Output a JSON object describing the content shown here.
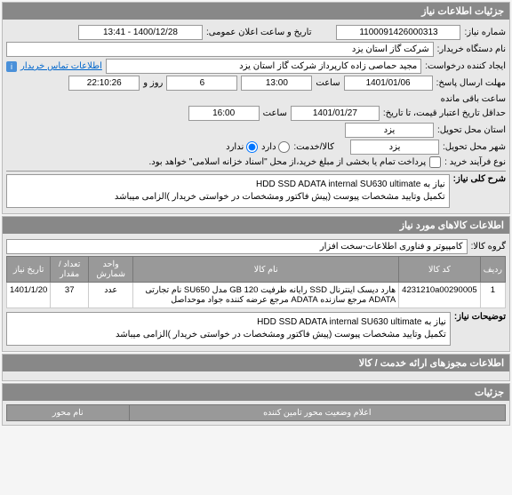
{
  "headers": {
    "main": "جزئیات اطلاعات نیاز",
    "items": "اطلاعات کالاهای مورد نیاز",
    "permits": "اطلاعات مجوزهای ارائه خدمت / کالا",
    "details": "جزئیات"
  },
  "labels": {
    "need_no": "شماره نیاز:",
    "pub_datetime": "تاریخ و ساعت اعلان عمومی:",
    "buyer_org": "نام دستگاه خریدار:",
    "creator": "ایجاد کننده درخواست:",
    "contact_link": "اطلاعات تماس خریدار",
    "deadline_resp": "مهلت ارسال پاسخ:",
    "credit_from": "حداقل تاریخ اعتبار قیمت، تا تاریخ:",
    "time_label": "ساعت",
    "day_and": "روز و",
    "remaining": "ساعت باقی مانده",
    "delivery_prov": "استان محل تحویل:",
    "delivery_city": "شهر محل تحویل:",
    "related_sep": "کالا/خدمت:",
    "related_yes": "دارد",
    "related_no": "ندارد",
    "purchase_type": "نوع فرآیند خرید :",
    "purchase_note": "پرداخت تمام یا بخشی از مبلغ خرید،از محل \"اسناد خزانه اسلامی\" خواهد بود.",
    "need_desc": "شرح کلی نیاز:",
    "need_to": "نیاز به",
    "goods_group": "گروه کالا:",
    "more_desc": "توضیحات نیاز:",
    "permit_status": "اعلام وضعیت محور تامین کننده",
    "permit_name": "نام محور"
  },
  "values": {
    "need_no": "1100091426000313",
    "pub_datetime": "1400/12/28 - 13:41",
    "buyer_org": "شرکت گاز استان یزد",
    "creator": "مجید حماصی زاده کارپرداز شرکت گاز استان یزد",
    "deadline_date": "1401/01/06",
    "deadline_time": "13:00",
    "deadline_days": "6",
    "deadline_remain": "22:10:26",
    "credit_date": "1401/01/27",
    "credit_time": "16:00",
    "province": "یزد",
    "city": "یزد",
    "desc_title": "HDD SSD ADATA internal SU630 ultimate",
    "desc_body": "تکمیل وتایید مشخصات پیوست (پیش فاکتور ومشخصات در خواستی خریدار )الزامی میباشد",
    "goods_group": "کامپیوتر و فناوری اطلاعات-سخت افزار"
  },
  "table": {
    "cols": {
      "row": "ردیف",
      "code": "کد کالا",
      "name": "نام کالا",
      "unit": "واحد شمارش",
      "qty": "تعداد / مقدار",
      "date": "تاریخ نیاز"
    },
    "rows": [
      {
        "idx": "1",
        "code": "4231210a00290005",
        "name": "هارد دیسک اینترنال SSD رایانه ظرفیت GB 120 مدل SU650 نام تجارتی ADATA مرجع سازنده ADATA مرجع عرضه کننده جواد موحداصل",
        "unit": "عدد",
        "qty": "37",
        "date": "1401/1/20"
      }
    ]
  }
}
